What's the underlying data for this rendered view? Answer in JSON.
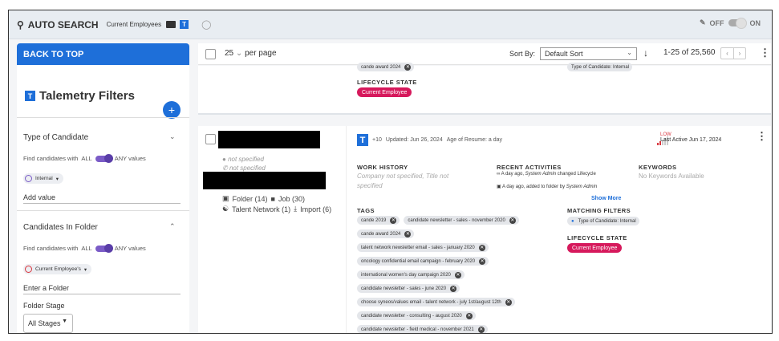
{
  "topbar": {
    "auto_search": "AUTO SEARCH",
    "current": "Current Employees",
    "t_badge": "T",
    "toggle_off": "OFF",
    "toggle_on": "ON"
  },
  "sidebar": {
    "back_to_top": "BACK TO TOP",
    "title": "Talemetry Filters",
    "title_badge": "T",
    "add": "+",
    "sections": [
      {
        "title": "Type of Candidate",
        "find_prefix": "Find candidates with",
        "all": "ALL",
        "any_values": "ANY values",
        "chip": "Internal",
        "input_placeholder": "Add value"
      },
      {
        "title": "Candidates In Folder",
        "find_prefix": "Find candidates with",
        "all": "ALL",
        "any_values": "ANY values",
        "chip": "Current Employee's",
        "input_placeholder": "Enter a Folder",
        "stage_label": "Folder Stage",
        "stage_value": "All Stages"
      }
    ]
  },
  "toolbar": {
    "per_page_value": "25",
    "per_page_label": "per page",
    "sort_label": "Sort By:",
    "sort_value": "Default Sort",
    "sort_arrow": "↓",
    "count": "1-25 of 25,560",
    "prev": "‹",
    "next": "›"
  },
  "card_prev": {
    "chip_partial": "cande award 2024",
    "type_chip_partial": "Type of Candidate: Internal",
    "lifecycle_title": "LIFECYCLE STATE",
    "lifecycle_value": "Current Employee"
  },
  "card": {
    "location": "not specified",
    "phone": "not specified",
    "folder": "Folder (14)",
    "job": "Job (30)",
    "talent_network": "Talent Network (1)",
    "import": "Import (6)",
    "t_badge": "T",
    "plus_count": "+10",
    "updated": "Updated: Jun 26, 2024",
    "resume_age": "Age of Resume: a day",
    "activity_level": "LOW",
    "last_active": "Last Active Jun 17, 2024",
    "work_history_title": "WORK HISTORY",
    "work_history_value": "Company not specified, Title not specified",
    "recent_title": "RECENT ACTIVITIES",
    "recent_1_prefix": "A day ago,",
    "recent_1_actor": "System Admin",
    "recent_1_suffix": "changed Lifecycle",
    "recent_2_prefix": "A day ago, added to folder by",
    "recent_2_actor": "System Admin",
    "show_more": "Show More",
    "keywords_title": "KEYWORDS",
    "keywords_value": "No Keywords Available",
    "tags_title": "TAGS",
    "tags_row1": [
      "cande 2019",
      "candidate newsletter - sales - november 2020"
    ],
    "tags": [
      "cande award 2024",
      "talent network newsletter email - sales - january 2020",
      "oncology confidential email campaign - february 2020",
      "international women's day campaign 2020",
      "candidate newsletter - sales - june 2020",
      "choose syneos/values email - talent network - july 1st/august 12th",
      "candidate newsletter - consulting - august 2020",
      "candidate newsletter - field medical - november 2021"
    ],
    "matching_title": "MATCHING FILTERS",
    "matching_chip": "Type of Candidate: Internal",
    "lifecycle_title": "LIFECYCLE STATE",
    "lifecycle_value": "Current Employee"
  },
  "colors": {
    "accent": "#1e6fd9",
    "lifecycle": "#d6195c",
    "toggle": "#7b5cc7",
    "low": "#d9363e"
  }
}
